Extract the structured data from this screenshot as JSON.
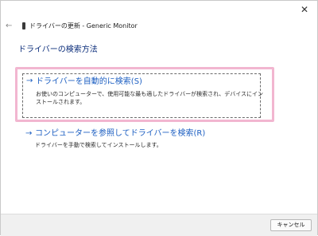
{
  "window": {
    "close_glyph": "✕",
    "back_glyph": "←",
    "title": "ドライバーの更新 - Generic Monitor"
  },
  "page": {
    "title": "ドライバーの検索方法"
  },
  "options": [
    {
      "arrow": "→",
      "label": "ドライバーを自動的に検索(S)",
      "description": "お使いのコンピューターで、使用可能な最も適したドライバーが検索され、デバイスにインストールされます。"
    },
    {
      "arrow": "→",
      "label": "コンピューターを参照してドライバーを検索(R)",
      "description": "ドライバーを手動で検索してインストールします。"
    }
  ],
  "footer": {
    "cancel_label": "キャンセル"
  },
  "colors": {
    "accent": "#1d5fc2",
    "highlight": "#f2b6d0",
    "title": "#0a2c7a"
  }
}
